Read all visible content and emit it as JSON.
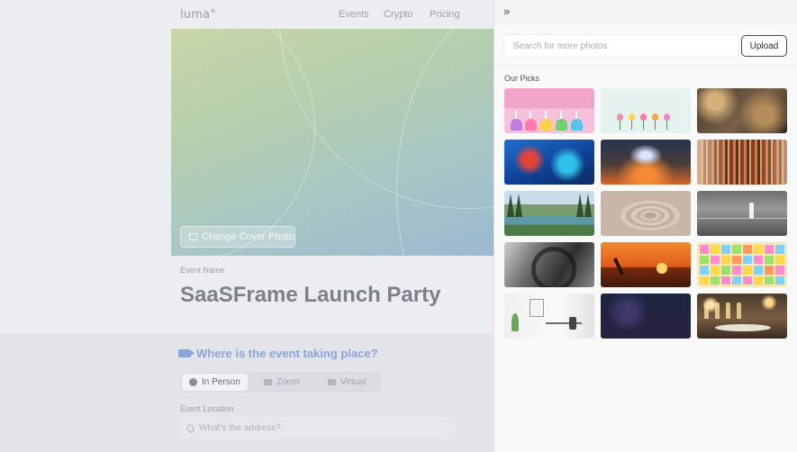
{
  "background": {
    "logo": "luma°",
    "nav": [
      "Events",
      "Crypto",
      "Pricing"
    ],
    "cover_button": "Change Cover Photo",
    "event_name_label": "Event Name",
    "event_name": "SaaSFrame Launch Party",
    "location_heading": "Where is the event taking place?",
    "location_tabs": [
      {
        "label": "In Person",
        "active": true,
        "icon": "globe-icon"
      },
      {
        "label": "Zoom",
        "active": false,
        "icon": "video-icon"
      },
      {
        "label": "Virtual",
        "active": false,
        "icon": "monitor-icon"
      }
    ],
    "event_location_label": "Event Location",
    "address_placeholder": "What's the address?"
  },
  "panel": {
    "collapse_icon": "double-chevron-right-icon",
    "search_placeholder": "Search for more photos",
    "upload_label": "Upload",
    "picks_label": "Our Picks",
    "photos": [
      {
        "name": "photo-cupcakes"
      },
      {
        "name": "photo-tulips"
      },
      {
        "name": "photo-candles-books"
      },
      {
        "name": "photo-dj-turntable"
      },
      {
        "name": "photo-concert-stage"
      },
      {
        "name": "photo-library"
      },
      {
        "name": "photo-mountain-lake"
      },
      {
        "name": "photo-zen-sand"
      },
      {
        "name": "photo-bw-corridor"
      },
      {
        "name": "photo-bw-camera"
      },
      {
        "name": "photo-sunset-yoga"
      },
      {
        "name": "photo-sticky-notes"
      },
      {
        "name": "photo-office-desk"
      },
      {
        "name": "photo-dark-abstract"
      },
      {
        "name": "photo-dinner-party"
      }
    ]
  }
}
